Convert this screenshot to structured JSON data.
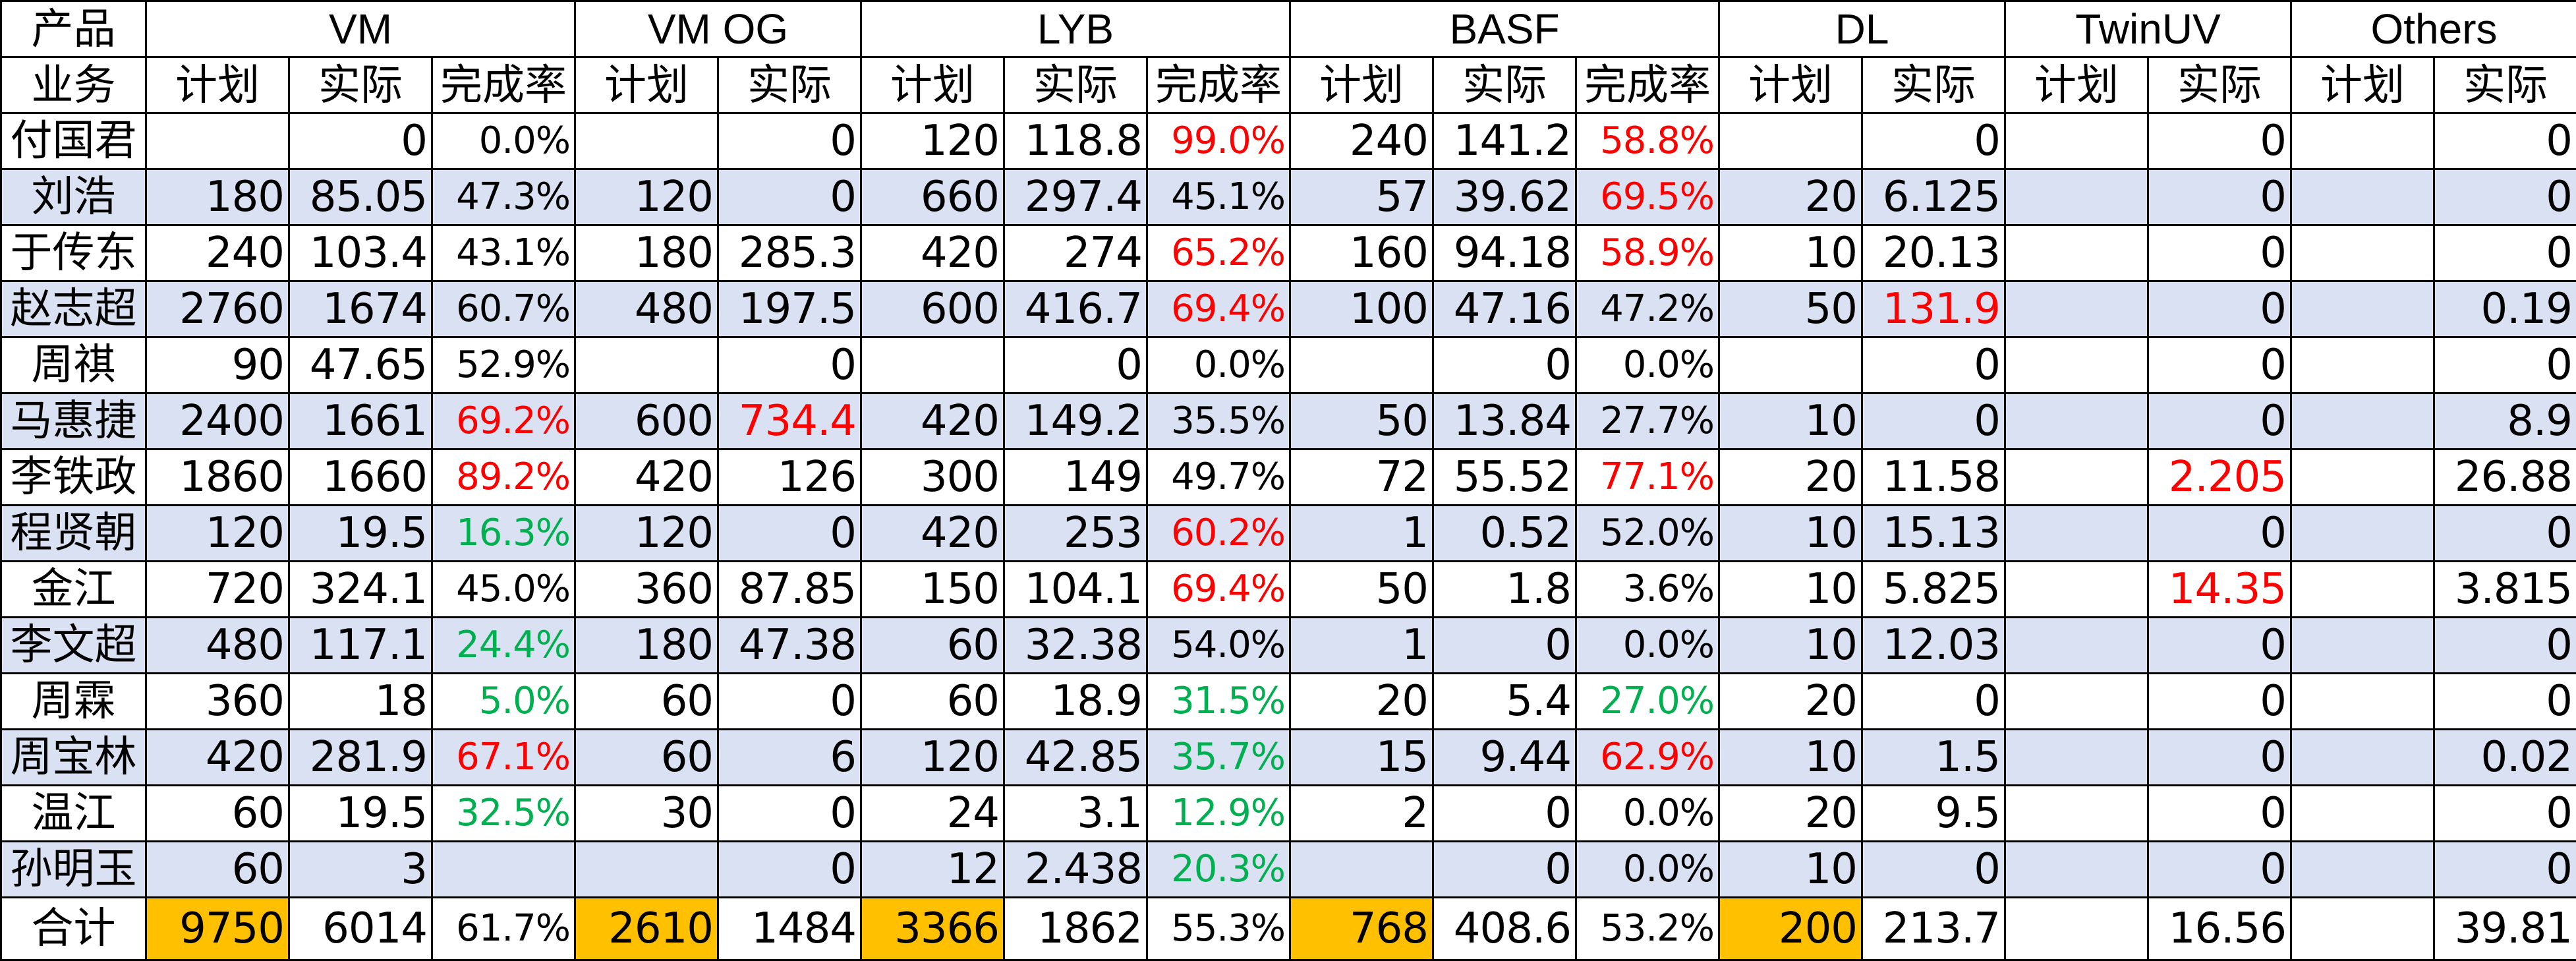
{
  "header": {
    "product_label": "产品",
    "business_label": "业务",
    "groups": [
      "VM",
      "VM OG",
      "LYB",
      "BASF",
      "DL",
      "TwinUV",
      "Others"
    ],
    "plan_label": "计划",
    "actual_label": "实际",
    "rate_label": "完成率"
  },
  "colors": {
    "band": "#d9e1f2",
    "highlight": "#ffc000",
    "over_target": "#ff0000",
    "under_target": "#00b050"
  },
  "rows": [
    {
      "name": "付国君",
      "cells": [
        {
          "v": ""
        },
        {
          "v": "0"
        },
        {
          "v": "0.0%"
        },
        {
          "v": ""
        },
        {
          "v": "0"
        },
        {
          "v": "120"
        },
        {
          "v": "118.8"
        },
        {
          "v": "99.0%",
          "c": "red"
        },
        {
          "v": "240"
        },
        {
          "v": "141.2"
        },
        {
          "v": "58.8%",
          "c": "red"
        },
        {
          "v": ""
        },
        {
          "v": "0"
        },
        {
          "v": ""
        },
        {
          "v": "0"
        },
        {
          "v": ""
        },
        {
          "v": "0"
        }
      ]
    },
    {
      "name": "刘浩",
      "cells": [
        {
          "v": "180"
        },
        {
          "v": "85.05"
        },
        {
          "v": "47.3%"
        },
        {
          "v": "120"
        },
        {
          "v": "0"
        },
        {
          "v": "660"
        },
        {
          "v": "297.4"
        },
        {
          "v": "45.1%"
        },
        {
          "v": "57"
        },
        {
          "v": "39.62"
        },
        {
          "v": "69.5%",
          "c": "red"
        },
        {
          "v": "20"
        },
        {
          "v": "6.125"
        },
        {
          "v": ""
        },
        {
          "v": "0"
        },
        {
          "v": ""
        },
        {
          "v": "0"
        }
      ]
    },
    {
      "name": "于传东",
      "cells": [
        {
          "v": "240"
        },
        {
          "v": "103.4"
        },
        {
          "v": "43.1%"
        },
        {
          "v": "180"
        },
        {
          "v": "285.3"
        },
        {
          "v": "420"
        },
        {
          "v": "274"
        },
        {
          "v": "65.2%",
          "c": "red"
        },
        {
          "v": "160"
        },
        {
          "v": "94.18"
        },
        {
          "v": "58.9%",
          "c": "red"
        },
        {
          "v": "10"
        },
        {
          "v": "20.13"
        },
        {
          "v": ""
        },
        {
          "v": "0"
        },
        {
          "v": ""
        },
        {
          "v": "0"
        }
      ]
    },
    {
      "name": "赵志超",
      "cells": [
        {
          "v": "2760"
        },
        {
          "v": "1674"
        },
        {
          "v": "60.7%"
        },
        {
          "v": "480"
        },
        {
          "v": "197.5"
        },
        {
          "v": "600"
        },
        {
          "v": "416.7"
        },
        {
          "v": "69.4%",
          "c": "red"
        },
        {
          "v": "100"
        },
        {
          "v": "47.16"
        },
        {
          "v": "47.2%"
        },
        {
          "v": "50"
        },
        {
          "v": "131.9",
          "c": "red"
        },
        {
          "v": ""
        },
        {
          "v": "0"
        },
        {
          "v": ""
        },
        {
          "v": "0.19"
        }
      ]
    },
    {
      "name": "周祺",
      "cells": [
        {
          "v": "90"
        },
        {
          "v": "47.65"
        },
        {
          "v": "52.9%"
        },
        {
          "v": ""
        },
        {
          "v": "0"
        },
        {
          "v": ""
        },
        {
          "v": "0"
        },
        {
          "v": "0.0%"
        },
        {
          "v": ""
        },
        {
          "v": "0"
        },
        {
          "v": "0.0%"
        },
        {
          "v": ""
        },
        {
          "v": "0"
        },
        {
          "v": ""
        },
        {
          "v": "0"
        },
        {
          "v": ""
        },
        {
          "v": "0"
        }
      ]
    },
    {
      "name": "马惠捷",
      "cells": [
        {
          "v": "2400"
        },
        {
          "v": "1661"
        },
        {
          "v": "69.2%",
          "c": "red"
        },
        {
          "v": "600"
        },
        {
          "v": "734.4",
          "c": "red"
        },
        {
          "v": "420"
        },
        {
          "v": "149.2"
        },
        {
          "v": "35.5%"
        },
        {
          "v": "50"
        },
        {
          "v": "13.84"
        },
        {
          "v": "27.7%"
        },
        {
          "v": "10"
        },
        {
          "v": "0"
        },
        {
          "v": ""
        },
        {
          "v": "0"
        },
        {
          "v": ""
        },
        {
          "v": "8.9"
        }
      ]
    },
    {
      "name": "李铁政",
      "cells": [
        {
          "v": "1860"
        },
        {
          "v": "1660"
        },
        {
          "v": "89.2%",
          "c": "red"
        },
        {
          "v": "420"
        },
        {
          "v": "126"
        },
        {
          "v": "300"
        },
        {
          "v": "149"
        },
        {
          "v": "49.7%"
        },
        {
          "v": "72"
        },
        {
          "v": "55.52"
        },
        {
          "v": "77.1%",
          "c": "red"
        },
        {
          "v": "20"
        },
        {
          "v": "11.58"
        },
        {
          "v": ""
        },
        {
          "v": "2.205",
          "c": "red"
        },
        {
          "v": ""
        },
        {
          "v": "26.88"
        }
      ]
    },
    {
      "name": "程贤朝",
      "cells": [
        {
          "v": "120"
        },
        {
          "v": "19.5"
        },
        {
          "v": "16.3%",
          "c": "green"
        },
        {
          "v": "120"
        },
        {
          "v": "0"
        },
        {
          "v": "420"
        },
        {
          "v": "253"
        },
        {
          "v": "60.2%",
          "c": "red"
        },
        {
          "v": "1"
        },
        {
          "v": "0.52"
        },
        {
          "v": "52.0%"
        },
        {
          "v": "10"
        },
        {
          "v": "15.13"
        },
        {
          "v": ""
        },
        {
          "v": "0"
        },
        {
          "v": ""
        },
        {
          "v": "0"
        }
      ]
    },
    {
      "name": "金江",
      "cells": [
        {
          "v": "720"
        },
        {
          "v": "324.1"
        },
        {
          "v": "45.0%"
        },
        {
          "v": "360"
        },
        {
          "v": "87.85"
        },
        {
          "v": "150"
        },
        {
          "v": "104.1"
        },
        {
          "v": "69.4%",
          "c": "red"
        },
        {
          "v": "50"
        },
        {
          "v": "1.8"
        },
        {
          "v": "3.6%"
        },
        {
          "v": "10"
        },
        {
          "v": "5.825"
        },
        {
          "v": ""
        },
        {
          "v": "14.35",
          "c": "red"
        },
        {
          "v": ""
        },
        {
          "v": "3.815"
        }
      ]
    },
    {
      "name": "李文超",
      "cells": [
        {
          "v": "480"
        },
        {
          "v": "117.1"
        },
        {
          "v": "24.4%",
          "c": "green"
        },
        {
          "v": "180"
        },
        {
          "v": "47.38"
        },
        {
          "v": "60"
        },
        {
          "v": "32.38"
        },
        {
          "v": "54.0%"
        },
        {
          "v": "1"
        },
        {
          "v": "0"
        },
        {
          "v": "0.0%"
        },
        {
          "v": "10"
        },
        {
          "v": "12.03"
        },
        {
          "v": ""
        },
        {
          "v": "0"
        },
        {
          "v": ""
        },
        {
          "v": "0"
        }
      ]
    },
    {
      "name": "周霖",
      "cells": [
        {
          "v": "360"
        },
        {
          "v": "18"
        },
        {
          "v": "5.0%",
          "c": "green"
        },
        {
          "v": "60"
        },
        {
          "v": "0"
        },
        {
          "v": "60"
        },
        {
          "v": "18.9"
        },
        {
          "v": "31.5%",
          "c": "green"
        },
        {
          "v": "20"
        },
        {
          "v": "5.4"
        },
        {
          "v": "27.0%",
          "c": "green"
        },
        {
          "v": "20"
        },
        {
          "v": "0"
        },
        {
          "v": ""
        },
        {
          "v": "0"
        },
        {
          "v": ""
        },
        {
          "v": "0"
        }
      ]
    },
    {
      "name": "周宝林",
      "cells": [
        {
          "v": "420"
        },
        {
          "v": "281.9"
        },
        {
          "v": "67.1%",
          "c": "red"
        },
        {
          "v": "60"
        },
        {
          "v": "6"
        },
        {
          "v": "120"
        },
        {
          "v": "42.85"
        },
        {
          "v": "35.7%",
          "c": "green"
        },
        {
          "v": "15"
        },
        {
          "v": "9.44"
        },
        {
          "v": "62.9%",
          "c": "red"
        },
        {
          "v": "10"
        },
        {
          "v": "1.5"
        },
        {
          "v": ""
        },
        {
          "v": "0"
        },
        {
          "v": ""
        },
        {
          "v": "0.02"
        }
      ]
    },
    {
      "name": "温江",
      "cells": [
        {
          "v": "60"
        },
        {
          "v": "19.5"
        },
        {
          "v": "32.5%",
          "c": "green"
        },
        {
          "v": "30"
        },
        {
          "v": "0"
        },
        {
          "v": "24"
        },
        {
          "v": "3.1"
        },
        {
          "v": "12.9%",
          "c": "green"
        },
        {
          "v": "2"
        },
        {
          "v": "0"
        },
        {
          "v": "0.0%"
        },
        {
          "v": "20"
        },
        {
          "v": "9.5"
        },
        {
          "v": ""
        },
        {
          "v": "0"
        },
        {
          "v": ""
        },
        {
          "v": "0"
        }
      ]
    },
    {
      "name": "孙明玉",
      "cells": [
        {
          "v": "60"
        },
        {
          "v": "3"
        },
        {
          "v": ""
        },
        {
          "v": ""
        },
        {
          "v": "0"
        },
        {
          "v": "12"
        },
        {
          "v": "2.438"
        },
        {
          "v": "20.3%",
          "c": "green"
        },
        {
          "v": ""
        },
        {
          "v": "0"
        },
        {
          "v": "0.0%"
        },
        {
          "v": "10"
        },
        {
          "v": "0"
        },
        {
          "v": ""
        },
        {
          "v": "0"
        },
        {
          "v": ""
        },
        {
          "v": "0"
        }
      ]
    }
  ],
  "total": {
    "name": "合计",
    "cells": [
      {
        "v": "9750",
        "hl": true
      },
      {
        "v": "6014"
      },
      {
        "v": "61.7%"
      },
      {
        "v": "2610",
        "hl": true
      },
      {
        "v": "1484"
      },
      {
        "v": "3366",
        "hl": true
      },
      {
        "v": "1862"
      },
      {
        "v": "55.3%"
      },
      {
        "v": "768",
        "hl": true
      },
      {
        "v": "408.6"
      },
      {
        "v": "53.2%"
      },
      {
        "v": "200",
        "hl": true
      },
      {
        "v": "213.7"
      },
      {
        "v": ""
      },
      {
        "v": "16.56"
      },
      {
        "v": ""
      },
      {
        "v": "39.81"
      }
    ]
  }
}
